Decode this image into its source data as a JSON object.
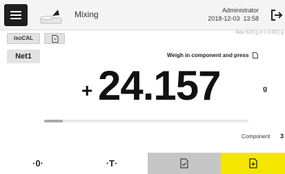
{
  "header": {
    "app_title": "Mixing",
    "user": "Administrator",
    "date": "2018-12-03",
    "time": "13:58"
  },
  "toolbar": {
    "isocal_label": "isoCAL",
    "range_info": "Max 620 g   d = 0.001 g"
  },
  "weighing": {
    "mode_label": "Net1",
    "instruction": "Weigh in component and press",
    "sign": "+",
    "value": "24.157",
    "unit": "g",
    "progress": 0.09
  },
  "component": {
    "label": "Component",
    "value": "3"
  },
  "bottom_bar": {
    "zero_label": "·0·",
    "tare_label": "·T·"
  },
  "colors": {
    "accent_yellow": "#f5e600",
    "header_bg": "#f4f4f4",
    "menu_dark": "#1e1e1e",
    "doc_button_gray": "#c6c6c6"
  },
  "icons": {
    "menu": "hamburger-icon",
    "balance": "balance-scale-icon",
    "logout": "logout-icon",
    "document": "document-icon",
    "protocol": "document-check-icon",
    "add": "document-add-icon"
  }
}
